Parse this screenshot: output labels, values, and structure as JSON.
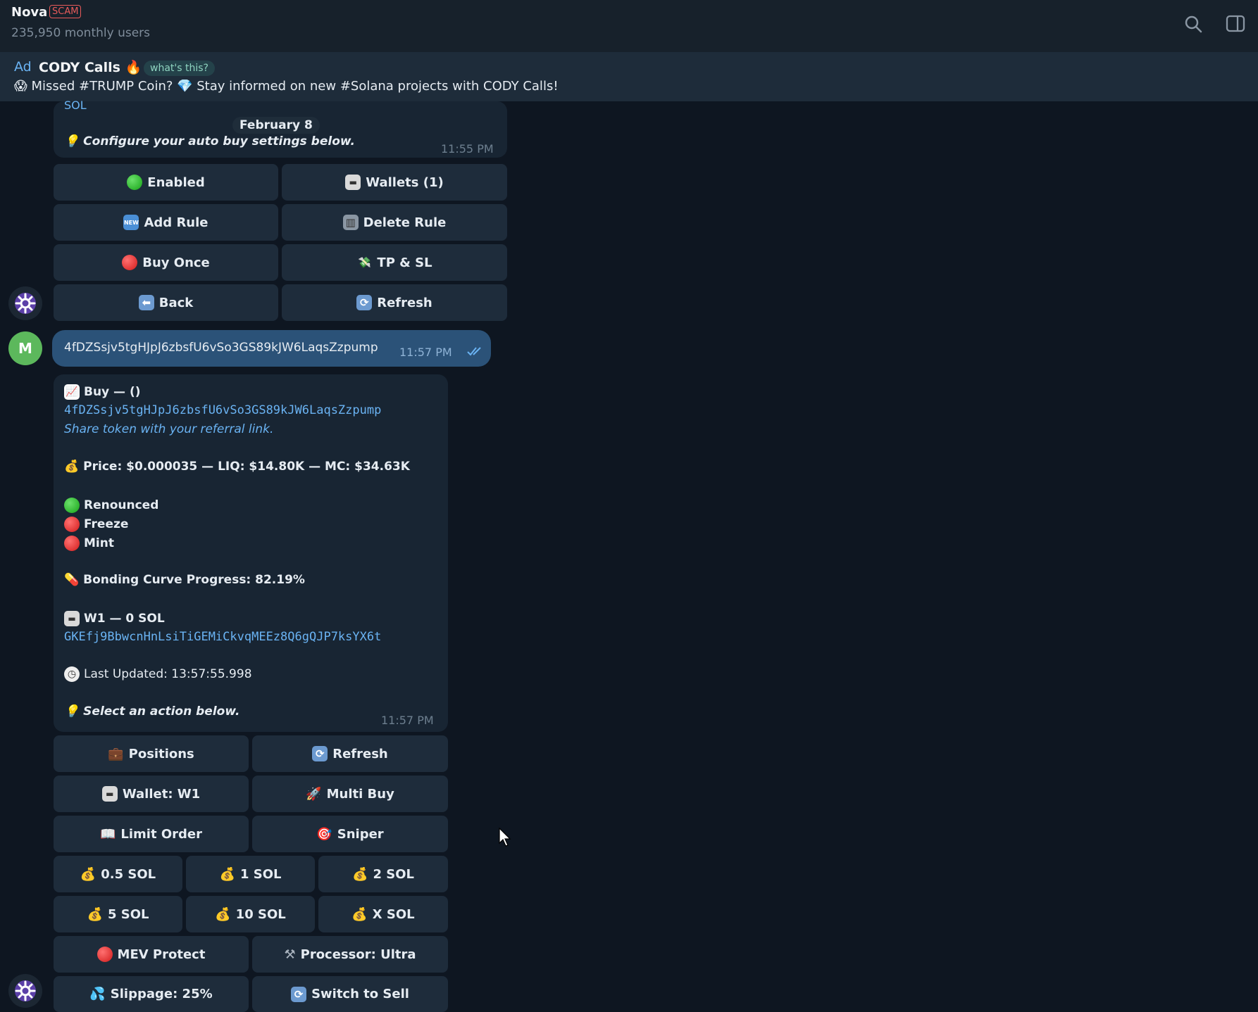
{
  "header": {
    "title": "Nova",
    "badge": "SCAM",
    "subtitle": "235,950 monthly users",
    "search_icon": "search-icon",
    "sidebar_icon": "sidebar-toggle-icon"
  },
  "ad": {
    "tag": "Ad",
    "title": "CODY Calls 🔥",
    "whats_this": "what's this?",
    "text": "😱 Missed #TRUMP Coin? 💎 Stay informed on new #Solana projects with CODY Calls!"
  },
  "msg1": {
    "top_fragment": "SOL",
    "date": "February 8",
    "configure": "Configure your auto buy settings below.",
    "time": "11:55 PM",
    "buttons": {
      "enabled": "Enabled",
      "wallets": "Wallets (1)",
      "add_rule": "Add Rule",
      "delete_rule": "Delete Rule",
      "buy_once": "Buy Once",
      "tp_sl": "TP & SL",
      "back": "Back",
      "refresh": "Refresh"
    }
  },
  "user_msg": {
    "avatar_letter": "M",
    "text": "4fDZSsjv5tgHJpJ6zbsfU6vSo3GS89kJW6LaqsZzpump",
    "time": "11:57 PM"
  },
  "msg2": {
    "buy_title": "Buy — ()",
    "address": "4fDZSsjv5tgHJpJ6zbsfU6vSo3GS89kJW6LaqsZzpump",
    "share_link": "Share token with your referral link.",
    "price_line": "Price: $0.000035 — LIQ: $14.80K — MC: $34.63K",
    "renounced": "Renounced",
    "freeze": "Freeze",
    "mint": "Mint",
    "bonding": "Bonding Curve Progress: 82.19%",
    "wallet_line": "W1 — 0 SOL",
    "wallet_address": "GKEfj9BbwcnHnLsiTiGEMiCkvqMEEz8Q6gQJP7ksYX6t",
    "last_updated": "Last Updated: 13:57:55.998",
    "select_action": "Select an action below.",
    "time": "11:57 PM",
    "buttons": {
      "positions": "Positions",
      "refresh": "Refresh",
      "wallet": "Wallet: W1",
      "multi_buy": "Multi Buy",
      "limit_order": "Limit Order",
      "sniper": "Sniper",
      "sol_05": "0.5 SOL",
      "sol_1": "1 SOL",
      "sol_2": "2 SOL",
      "sol_5": "5 SOL",
      "sol_10": "10 SOL",
      "sol_x": "X SOL",
      "mev": "MEV Protect",
      "processor": "Processor: Ultra",
      "slippage": "Slippage: 25%",
      "switch_sell": "Switch to Sell"
    }
  }
}
